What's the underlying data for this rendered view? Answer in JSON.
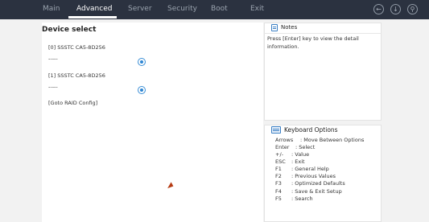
{
  "tabs": [
    {
      "label": "Main",
      "active": false
    },
    {
      "label": "Advanced",
      "active": true
    },
    {
      "label": "Server",
      "active": false
    },
    {
      "label": "Security",
      "active": false
    },
    {
      "label": "Boot",
      "active": false
    },
    {
      "label": "Exit",
      "active": false
    }
  ],
  "top_icons": [
    "back-icon",
    "save-icon",
    "search-icon"
  ],
  "main": {
    "title": "Device select",
    "devices": [
      {
        "name": "[0] SSSTC CA5-8D256",
        "sub": "-----",
        "selected": true
      },
      {
        "name": "[1] SSSTC CA5-8D256",
        "sub": "-----",
        "selected": true
      }
    ],
    "goto_raid": "[Goto RAID Config]"
  },
  "notes": {
    "title": "Notes",
    "text": "Press [Enter] key to view the detail information."
  },
  "keyboard": {
    "title": "Keyboard Options",
    "rows": [
      {
        "key": "Arrows",
        "desc": ": Move Between Options"
      },
      {
        "key": "Enter",
        "desc": ": Select"
      },
      {
        "key": "+/-",
        "desc": ": Value"
      },
      {
        "key": "ESC",
        "desc": ": Exit"
      },
      {
        "key": "F1",
        "desc": ": General Help"
      },
      {
        "key": "F2",
        "desc": ": Previous Values"
      },
      {
        "key": "F3",
        "desc": ": Optimized Defaults"
      },
      {
        "key": "F4",
        "desc": ": Save & Exit Setup"
      },
      {
        "key": "F5",
        "desc": ": Search"
      }
    ]
  },
  "colors": {
    "topbar": "#2b3240",
    "accent": "#2f86d3"
  }
}
